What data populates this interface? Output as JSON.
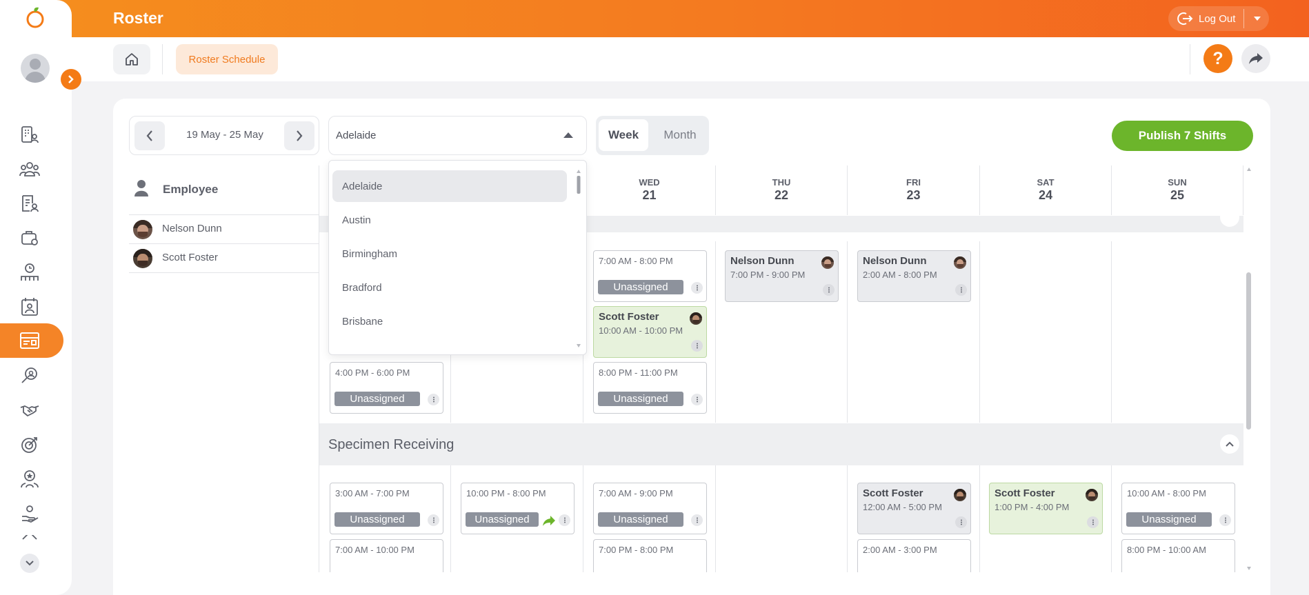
{
  "app": {
    "title": "Roster"
  },
  "topbar": {
    "logout_label": "Log Out"
  },
  "breadcrumb": {
    "current": "Roster Schedule"
  },
  "header": {
    "help_label": "?"
  },
  "toolbar": {
    "date_range": "19 May - 25 May",
    "location": "Adelaide",
    "view_week": "Week",
    "view_month": "Month",
    "publish_label": "Publish 7 Shifts"
  },
  "dropdown": {
    "options": [
      "Adelaide",
      "Austin",
      "Birmingham",
      "Bradford",
      "Brisbane"
    ],
    "selected": "Adelaide"
  },
  "employees": {
    "header": "Employee",
    "list": [
      {
        "name": "Nelson Dunn"
      },
      {
        "name": "Scott Foster"
      }
    ]
  },
  "days": [
    {
      "name": "WED",
      "date": "21"
    },
    {
      "name": "THU",
      "date": "22"
    },
    {
      "name": "FRI",
      "date": "23"
    },
    {
      "name": "SAT",
      "date": "24"
    },
    {
      "name": "SUN",
      "date": "25"
    }
  ],
  "sections": {
    "specimen_receiving": "Specimen Receiving"
  },
  "shifts": {
    "wed_1": {
      "time": "7:00 AM - 8:00 PM",
      "status": "Unassigned"
    },
    "wed_2": {
      "employee": "Scott Foster",
      "time": "10:00 AM - 10:00 PM"
    },
    "wed_3": {
      "time": "8:00 PM - 11:00 PM",
      "status": "Unassigned"
    },
    "thu_1": {
      "employee": "Nelson Dunn",
      "time": "7:00 PM - 9:00 PM"
    },
    "fri_1": {
      "employee": "Nelson Dunn",
      "time": "2:00 AM - 8:00 PM"
    },
    "mon_1": {
      "time": "4:00 PM - 6:00 PM",
      "status": "Unassigned"
    },
    "sr_mon_1": {
      "time": "3:00 AM - 7:00 PM",
      "status": "Unassigned"
    },
    "sr_mon_2": {
      "time": "7:00 AM - 10:00 PM"
    },
    "sr_tue_1": {
      "time": "10:00 PM - 8:00 PM",
      "status": "Unassigned"
    },
    "sr_wed_1": {
      "time": "7:00 AM - 9:00 PM",
      "status": "Unassigned"
    },
    "sr_wed_2": {
      "time": "7:00 PM - 8:00 PM"
    },
    "sr_fri_1": {
      "employee": "Scott Foster",
      "time": "12:00 AM - 5:00 PM"
    },
    "sr_fri_2": {
      "time": "2:00 AM - 3:00 PM"
    },
    "sr_sat_1": {
      "employee": "Scott Foster",
      "time": "1:00 PM - 4:00 PM"
    },
    "sr_sun_1": {
      "time": "10:00 AM - 8:00 PM",
      "status": "Unassigned"
    },
    "sr_sun_2": {
      "time": "8:00 PM - 10:00 AM"
    }
  },
  "colors": {
    "brand_orange": "#f47b16",
    "publish_green": "#6cb52b",
    "unassigned_badge": "#8d929c",
    "assigned_shift_green": "#e7f2dc"
  },
  "icons": [
    "home-icon",
    "share-icon",
    "logout-icon",
    "chevron-left-icon",
    "chevron-right-icon",
    "person-icon",
    "chevron-up-icon",
    "forward-arrow-icon",
    "kebab-icon"
  ]
}
